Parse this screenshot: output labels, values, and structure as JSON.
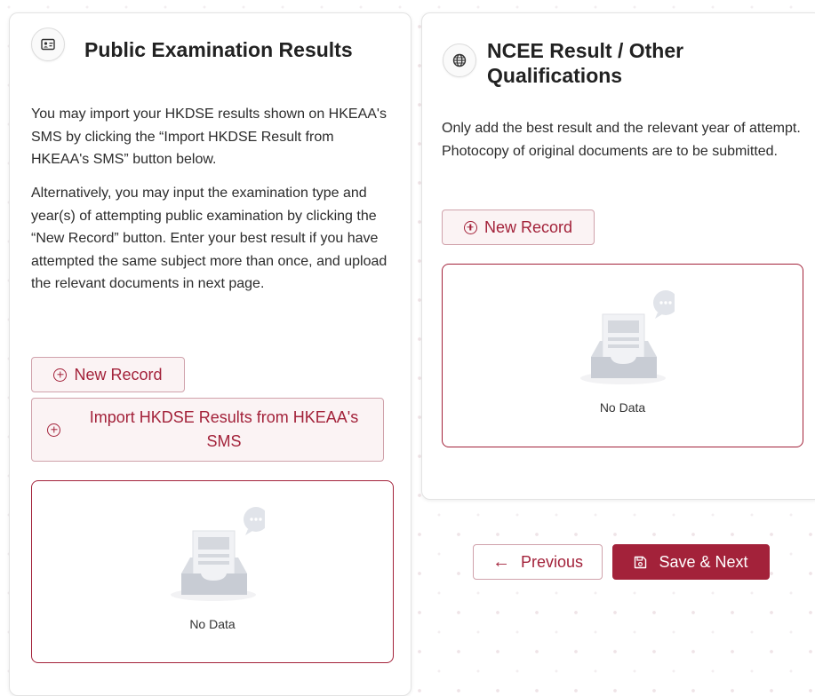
{
  "left_card": {
    "title": "Public Examination Results",
    "icon": "id-card-icon",
    "paragraph1": "You may import your HKDSE results shown on HKEAA's SMS by clicking the “Import HKDSE Result from HKEAA's SMS” button below.",
    "paragraph2": "Alternatively, you may input the examination type and year(s) of attempting public examination by clicking the “New Record” button. Enter your best result if you have attempted the same subject more than once, and upload the relevant documents in next page.",
    "new_record_label": "New Record",
    "import_label_line1": "Import HKDSE Results from HKEAA's",
    "import_label_line2": "SMS",
    "empty_label": "No Data"
  },
  "right_card": {
    "title_line1": "NCEE Result / Other",
    "title_line2": "Qualifications",
    "icon": "globe-icon",
    "paragraph": "Only add the best result and the relevant year of attempt. Photocopy of original documents are to be submitted.",
    "new_record_label": "New Record",
    "empty_label": "No Data"
  },
  "navigation": {
    "previous_label": "Previous",
    "save_next_label": "Save & Next"
  },
  "colors": {
    "brand": "#a3223a",
    "button_tint": "#fbf3f4",
    "border": "#d0a2ab"
  }
}
